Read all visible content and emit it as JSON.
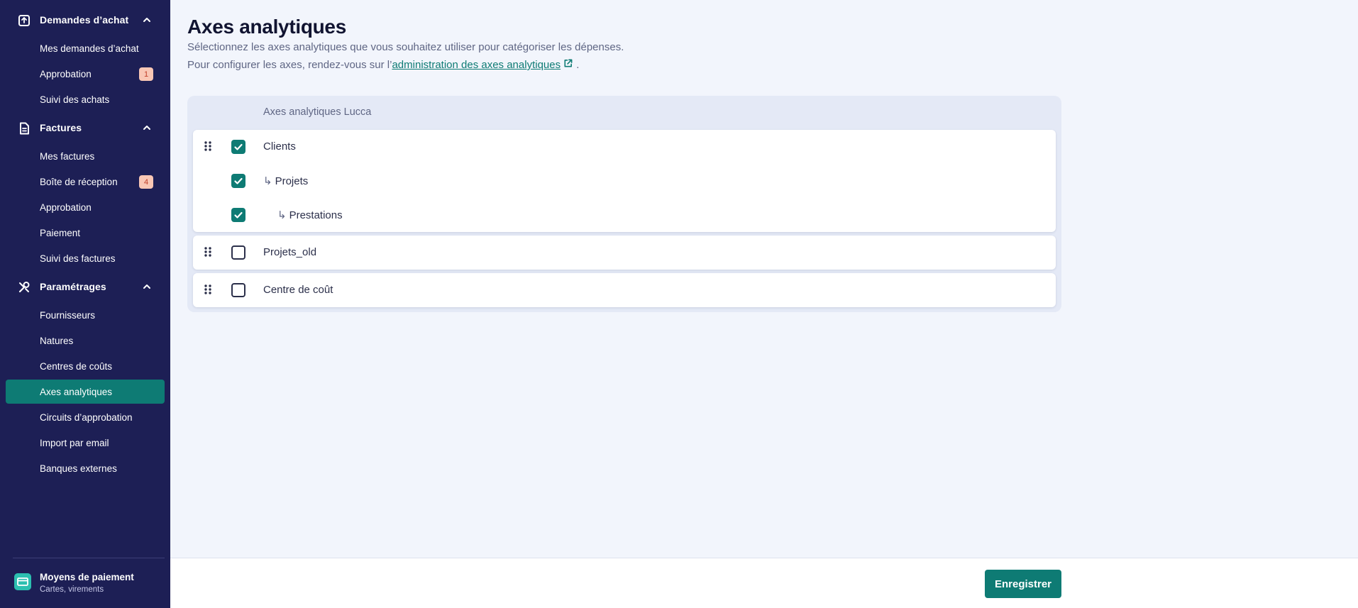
{
  "sidebar": {
    "sections": [
      {
        "label": "Demandes d’achat",
        "icon": "inbox-icon",
        "items": [
          {
            "label": "Mes demandes d’achat"
          },
          {
            "label": "Approbation",
            "badge": "1"
          },
          {
            "label": "Suivi des achats"
          }
        ]
      },
      {
        "label": "Factures",
        "icon": "document-icon",
        "items": [
          {
            "label": "Mes factures"
          },
          {
            "label": "Boîte de réception",
            "badge": "4"
          },
          {
            "label": "Approbation"
          },
          {
            "label": "Paiement"
          },
          {
            "label": "Suivi des factures"
          }
        ]
      },
      {
        "label": "Paramétrages",
        "icon": "tools-icon",
        "items": [
          {
            "label": "Fournisseurs"
          },
          {
            "label": "Natures"
          },
          {
            "label": "Centres de coûts"
          },
          {
            "label": "Axes analytiques"
          },
          {
            "label": "Circuits d’approbation"
          },
          {
            "label": "Import par email"
          },
          {
            "label": "Banques externes"
          }
        ]
      }
    ],
    "active_item": "Axes analytiques",
    "payment": {
      "title": "Moyens de paiement",
      "subtitle": "Cartes, virements",
      "icon": "card-icon"
    }
  },
  "main": {
    "title": "Axes analytiques",
    "description_line1": "Sélectionnez les axes analytiques que vous souhaitez utiliser pour catégoriser les dépenses.",
    "description_line2_prefix": "Pour configurer les axes, rendez-vous sur l’",
    "description_link": "administration des axes analytiques",
    "description_line2_suffix": ".",
    "panel_header": "Axes analytiques Lucca",
    "groups": [
      {
        "rows": [
          {
            "label": "Clients",
            "checked": true,
            "level": 0
          },
          {
            "label": "Projets",
            "checked": true,
            "level": 1
          },
          {
            "label": "Prestations",
            "checked": true,
            "level": 2
          }
        ]
      },
      {
        "rows": [
          {
            "label": "Projets_old",
            "checked": false,
            "level": 0
          }
        ]
      },
      {
        "rows": [
          {
            "label": "Centre de coût",
            "checked": false,
            "level": 0
          }
        ]
      }
    ],
    "child_arrow": "↳"
  },
  "footer": {
    "save_label": "Enregistrer"
  },
  "colors": {
    "sidebar_bg": "#1d1f55",
    "accent": "#0e7b74",
    "badge_bg": "#f9c7b5",
    "badge_text": "#c0402a",
    "page_bg": "#f2f5fc"
  }
}
